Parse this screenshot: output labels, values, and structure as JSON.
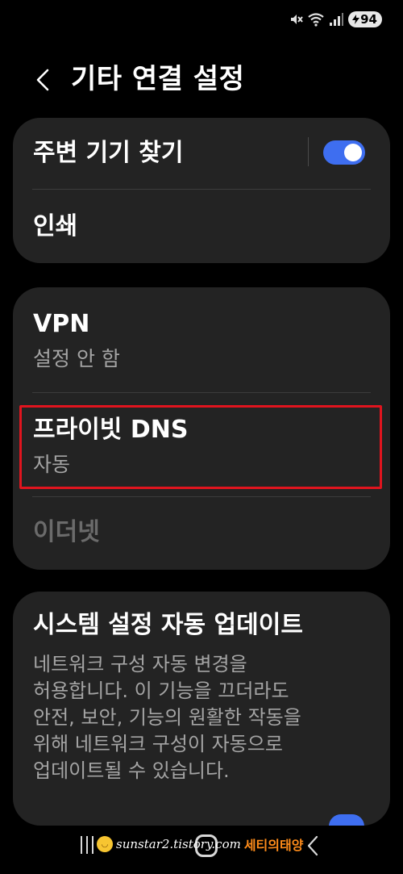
{
  "status_bar": {
    "icons": [
      "mute-icon",
      "wifi-icon",
      "signal-icon"
    ],
    "battery": "94"
  },
  "header": {
    "back_icon": "back-chevron-icon",
    "title": "기타 연결 설정"
  },
  "group1": {
    "nearby": {
      "title": "주변 기기 찾기",
      "toggle_on": true
    },
    "print": {
      "title": "인쇄"
    }
  },
  "group2": {
    "vpn": {
      "title": "VPN",
      "subtitle": "설정 안 함"
    },
    "private_dns": {
      "title": "프라이빗 DNS",
      "subtitle": "자동",
      "highlight_color": "#e0141e"
    },
    "ethernet": {
      "title": "이더넷",
      "enabled": false
    }
  },
  "group3": {
    "auto_update": {
      "title": "시스템 설정 자동 업데이트",
      "lines": [
        "네트워크 구성 자동 변경을",
        "허용합니다. 이 기능을 끄더라도",
        "안전, 보안, 기능의 원활한 작동을",
        "위해 네트워크 구성이 자동으로",
        "업데이트될 수 있습니다."
      ]
    }
  },
  "watermark": {
    "url": "sunstar2.tistory.com",
    "name": "세티의태양"
  },
  "colors": {
    "background": "#000000",
    "card": "#232323",
    "accent": "#3e6ef0",
    "secondary_text": "#a4a4a4",
    "disabled_text": "#6b6b6b"
  }
}
